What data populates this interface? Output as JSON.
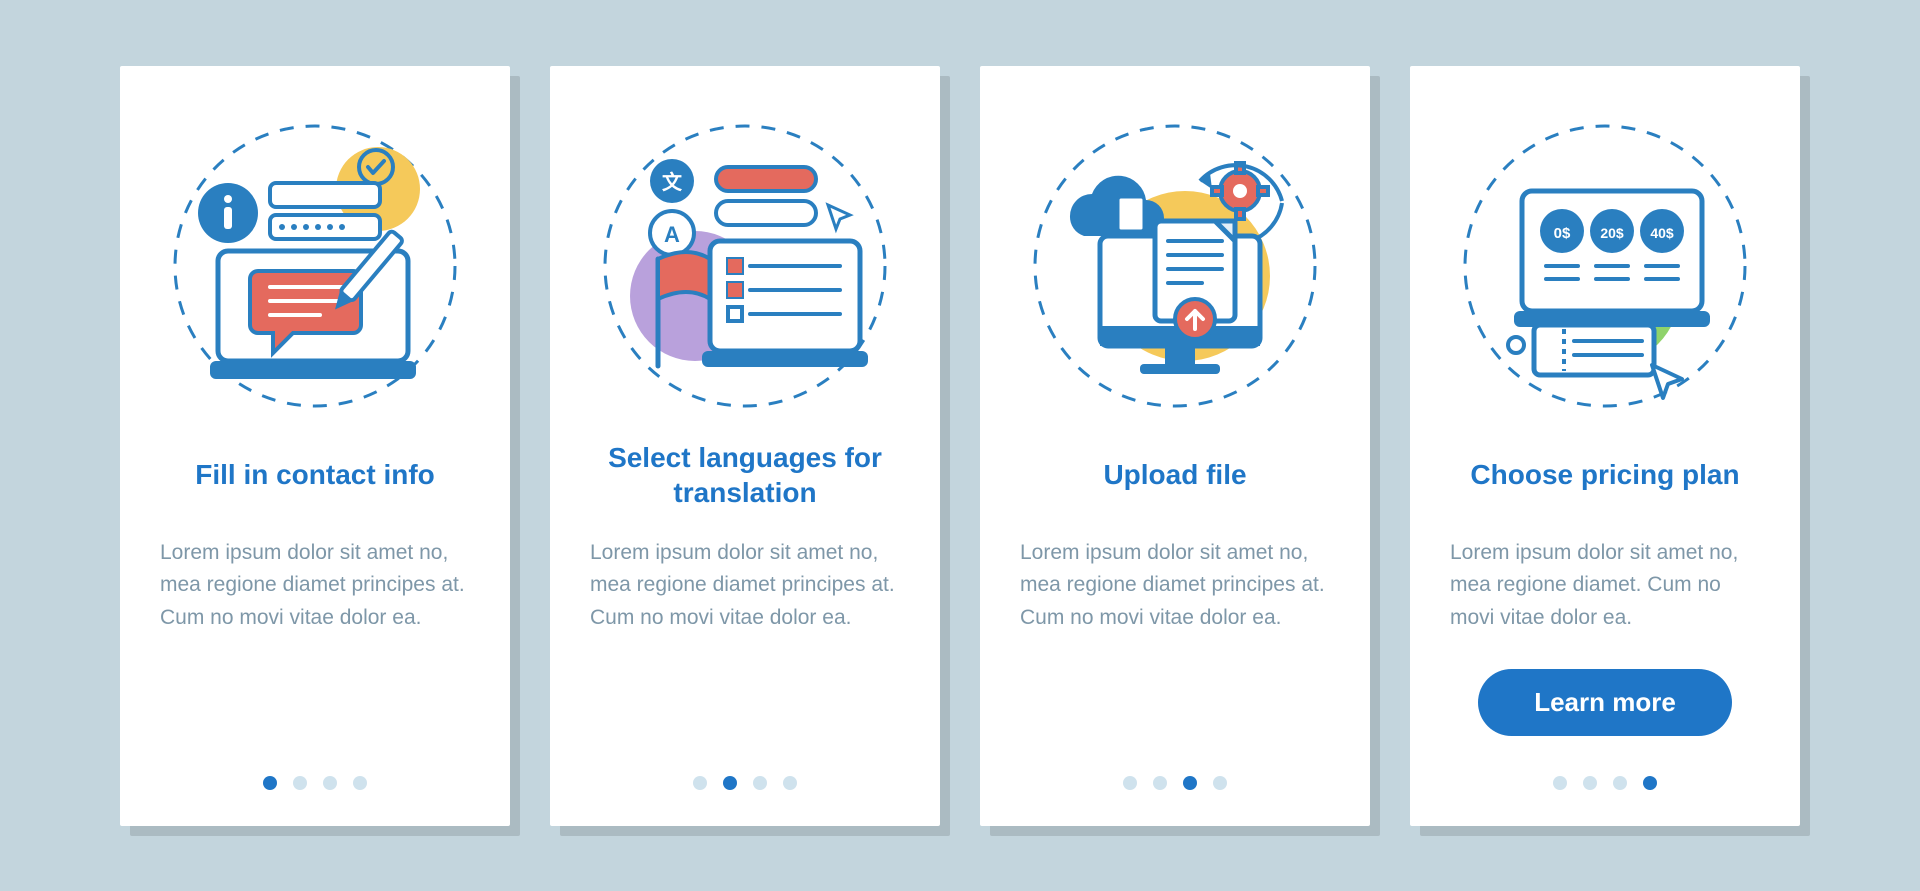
{
  "pager_total": 4,
  "cards": [
    {
      "title": "Fill in contact info",
      "desc": "Lorem ipsum dolor sit amet no, mea regione diamet principes at. Cum no movi vitae dolor ea.",
      "active_dot": 0,
      "has_button": false
    },
    {
      "title": "Select languages for translation",
      "desc": "Lorem ipsum dolor sit amet no, mea regione diamet principes at. Cum no movi vitae dolor ea.",
      "active_dot": 1,
      "has_button": false
    },
    {
      "title": "Upload file",
      "desc": "Lorem ipsum dolor sit amet no, mea regione diamet principes at. Cum no movi vitae dolor ea.",
      "active_dot": 2,
      "has_button": false
    },
    {
      "title": "Choose pricing plan",
      "desc": "Lorem ipsum dolor sit amet no, mea regione diamet. Cum no movi vitae dolor ea.",
      "active_dot": 3,
      "has_button": true
    }
  ],
  "button_label": "Learn more",
  "colors": {
    "primary": "#1f76c7",
    "accent_red": "#e46a5e",
    "accent_yellow": "#f5c95a",
    "accent_green": "#8fd36b",
    "accent_purple": "#b9a1dc",
    "stroke": "#2a7fc0"
  },
  "pricing_badges": [
    "0$",
    "20$",
    "40$"
  ]
}
